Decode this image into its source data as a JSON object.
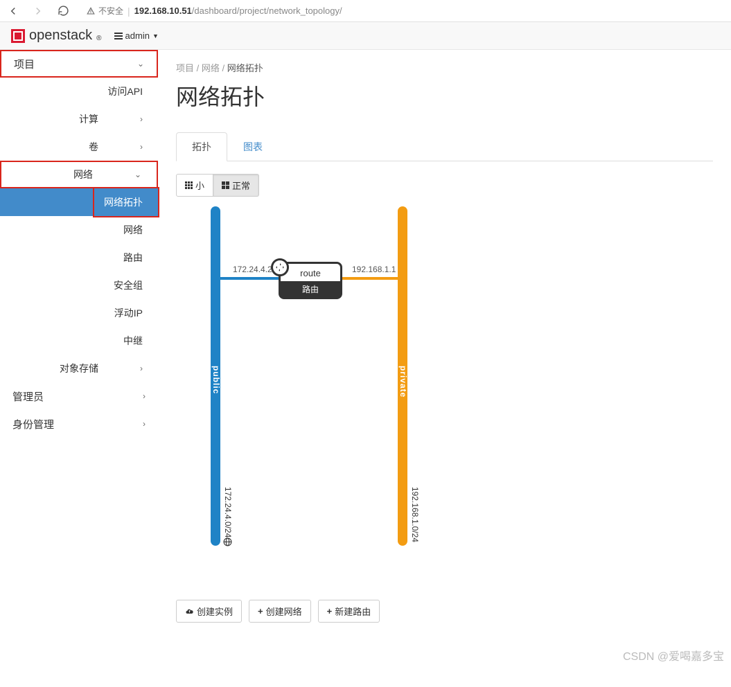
{
  "browser": {
    "insecure_label": "不安全",
    "url_host": "192.168.10.51",
    "url_path": "/dashboard/project/network_topology/"
  },
  "header": {
    "brand": "openstack",
    "project_selector": "admin"
  },
  "sidebar": {
    "project": "项目",
    "api": "访问API",
    "compute": "计算",
    "volume": "卷",
    "network": "网络",
    "network_items": {
      "topology": "网络拓扑",
      "networks": "网络",
      "routers": "路由",
      "secgroups": "安全组",
      "floatingips": "浮动IP",
      "trunks": "中继"
    },
    "object_storage": "对象存储",
    "admin": "管理员",
    "identity": "身份管理"
  },
  "breadcrumb": {
    "a": "项目",
    "b": "网络",
    "c": "网络拓扑"
  },
  "page_title": "网络拓扑",
  "tabs": {
    "topology": "拓扑",
    "graph": "图表"
  },
  "size_toggle": {
    "small": "小",
    "normal": "正常"
  },
  "topology": {
    "public": {
      "name": "public",
      "cidr": "172.24.4.0/24",
      "ip": "172.24.4.224",
      "color": "#1f83c6"
    },
    "private": {
      "name": "private",
      "cidr": "192.168.1.0/24",
      "ip": "192.168.1.1",
      "color": "#f39c12"
    },
    "router": {
      "name": "route",
      "type_label": "路由"
    }
  },
  "actions": {
    "launch_instance": "创建实例",
    "create_network": "创建网络",
    "create_router": "新建路由"
  },
  "watermark": "CSDN @爱喝嘉多宝"
}
